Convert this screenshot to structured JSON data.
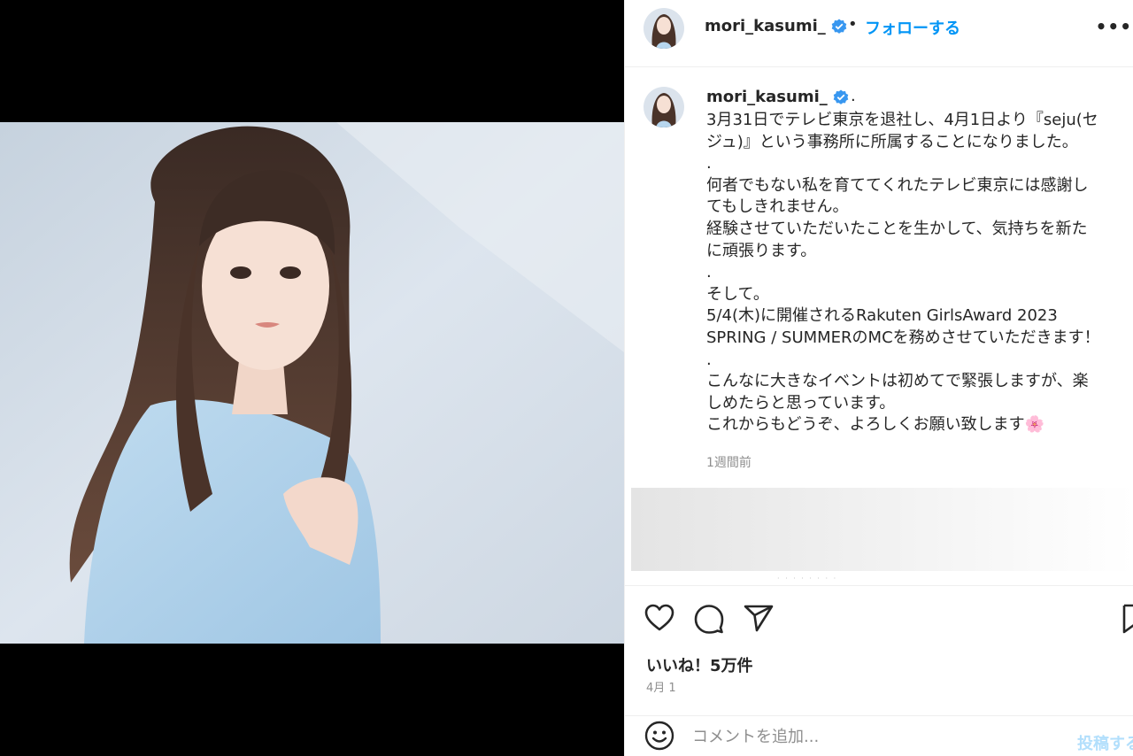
{
  "header": {
    "username": "mori_kasumi_",
    "separator": "•",
    "follow_label": "フォローする",
    "more_label": "•••"
  },
  "caption": {
    "username": "mori_kasumi_",
    "trailing": ".",
    "text": "3月31日でテレビ東京を退社し、4月1日より『seju(セ\nジュ)』という事務所に所属することになりました。\n.\n何者でもない私を育ててくれたテレビ東京には感謝し\nてもしきれません。\n経験させていただいたことを生かして、気持ちを新た\nに頑張ります。\n.\nそして。\n5/4(木)に開催されるRakuten GirlsAward 2023\nSPRING / SUMMERのMCを務めさせていただきます！\n.\nこんなに大きなイベントは初めてで緊張しますが、楽\nしめたらと思っています。\nこれからもどうぞ、よろしくお願い致します🌸",
    "time": "1週間前"
  },
  "actions": {
    "like_icon": "heart-icon",
    "comment_icon": "comment-icon",
    "share_icon": "paper-plane-icon",
    "save_icon": "bookmark-icon"
  },
  "likes": "いいね！5万件",
  "date": "4月 1",
  "add_comment": {
    "placeholder": "コメントを追加...",
    "post_label": "投稿する"
  },
  "colors": {
    "accent": "#0095f6",
    "verified": "#3897f0",
    "post_disabled": "#b2dffc"
  }
}
